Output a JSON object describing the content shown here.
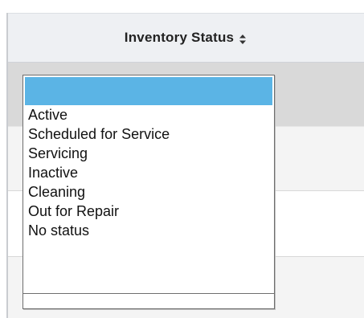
{
  "table": {
    "column_header": "Inventory Status",
    "sort_icon": "sort-updown-icon"
  },
  "status_dropdown": {
    "selected_value": "",
    "options": [
      "Active",
      "Scheduled for Service",
      "Servicing",
      "Inactive",
      "Cleaning",
      "Out for Repair",
      "No status"
    ],
    "highlight_color": "#5bb4e5"
  }
}
